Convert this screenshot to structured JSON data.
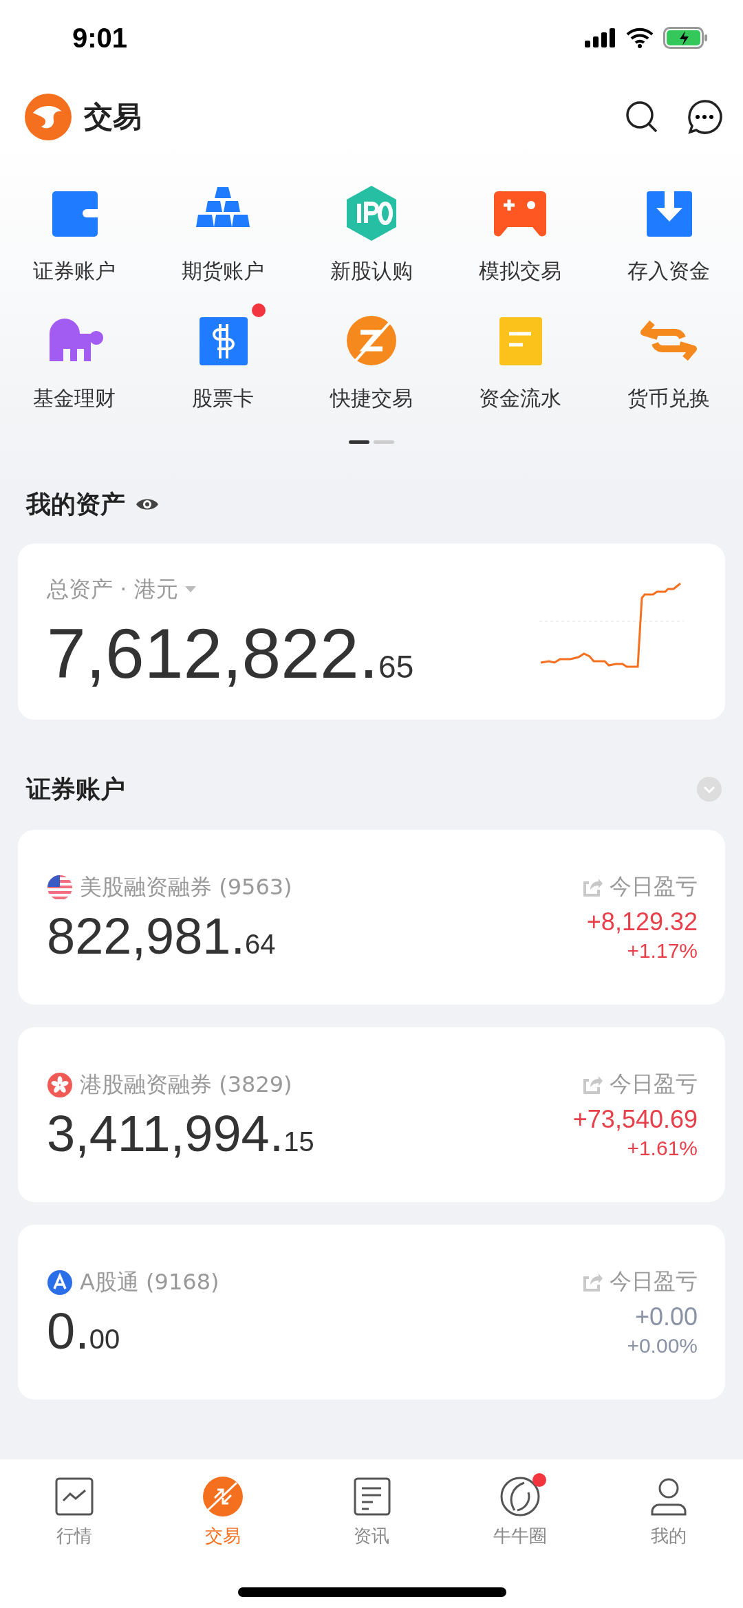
{
  "status_bar": {
    "time": "9:01"
  },
  "header": {
    "title": "交易"
  },
  "shortcuts": [
    {
      "label": "证券账户",
      "badge": false
    },
    {
      "label": "期货账户",
      "badge": false
    },
    {
      "label": "新股认购",
      "badge": false
    },
    {
      "label": "模拟交易",
      "badge": false
    },
    {
      "label": "存入资金",
      "badge": false
    },
    {
      "label": "基金理财",
      "badge": false
    },
    {
      "label": "股票卡",
      "badge": true
    },
    {
      "label": "快捷交易",
      "badge": false
    },
    {
      "label": "资金流水",
      "badge": false
    },
    {
      "label": "货币兑换",
      "badge": false
    }
  ],
  "pager": [
    {
      "selected": true
    },
    {
      "selected": false
    }
  ],
  "assets": {
    "title": "我的资产",
    "total_label": "总资产 · 港元",
    "integer": "7,612,822.",
    "decimal": "65"
  },
  "accounts_section": {
    "title": "证券账户"
  },
  "accounts": [
    {
      "name": "美股融资融券 (9563)",
      "pnl_label": "今日盈亏",
      "integer": "822,981.",
      "decimal": "64",
      "pnl": "+8,129.32",
      "pnl_pct": "+1.17%",
      "color": "#e8404a"
    },
    {
      "name": "港股融资融券 (3829)",
      "pnl_label": "今日盈亏",
      "integer": "3,411,994.",
      "decimal": "15",
      "pnl": "+73,540.69",
      "pnl_pct": "+1.61%",
      "color": "#e8404a"
    },
    {
      "name": "A股通 (9168)",
      "pnl_label": "今日盈亏",
      "integer": "0.",
      "decimal": "00",
      "pnl": "+0.00",
      "pnl_pct": "+0.00%",
      "color": "#8a93a6"
    }
  ],
  "tabs": [
    {
      "label": "行情",
      "selected": false,
      "badge": false
    },
    {
      "label": "交易",
      "selected": true,
      "badge": false
    },
    {
      "label": "资讯",
      "selected": false,
      "badge": false
    },
    {
      "label": "牛牛圈",
      "selected": false,
      "badge": true
    },
    {
      "label": "我的",
      "selected": false,
      "badge": false
    }
  ]
}
